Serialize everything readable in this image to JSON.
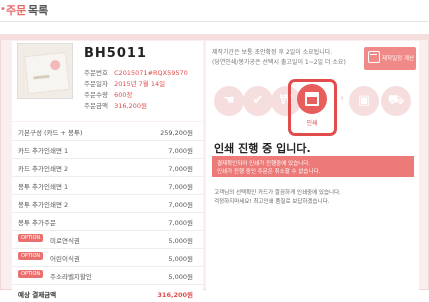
{
  "header": {
    "title_accent": "주문",
    "title_rest": "목록"
  },
  "order": {
    "code": "BH5011",
    "fields": [
      {
        "label": "주문번호",
        "value": "C2015071#RQX59570"
      },
      {
        "label": "주문일자",
        "value": "2015년 7월 14일"
      },
      {
        "label": "주문수량",
        "value": "600장"
      },
      {
        "label": "주문금액",
        "value": "316,200원"
      }
    ]
  },
  "price_rows": [
    {
      "label": "기본구성 (카드 + 봉투)",
      "value": "259,200원"
    },
    {
      "label": "카드 추가인쇄면 1",
      "value": "7,000원"
    },
    {
      "label": "카드 추가인쇄면 2",
      "value": "7,000원"
    },
    {
      "label": "봉투 추가인쇄면 1",
      "value": "7,000원"
    },
    {
      "label": "봉투 추가인쇄면 2",
      "value": "7,000원"
    },
    {
      "label": "봉투 추가주문",
      "value": "7,000원"
    }
  ],
  "option_rows": [
    {
      "badge": "OPTION",
      "label": "미로연식권",
      "value": "5,000원"
    },
    {
      "badge": "OPTION",
      "label": "어린이식권",
      "value": "5,000원"
    },
    {
      "badge": "OPTION",
      "label": "주소라벨지할인",
      "value": "5,000원"
    }
  ],
  "total": {
    "label": "예상 결제금액",
    "value": "316,200원"
  },
  "notice": {
    "line1": "제작기간은 보통 초안확정 후 2일이 소요됩니다.",
    "line2": "(당연인쇄/봉가공은 선택시 출고일이 1~2일 더 소요)"
  },
  "schedule_button": {
    "label": "제작일정 계산"
  },
  "steps": [
    {
      "icon": "hand-icon",
      "glyph": "☚"
    },
    {
      "icon": "check-icon",
      "glyph": "✔"
    },
    {
      "icon": "coin-icon",
      "glyph": "₩"
    },
    {
      "icon": "print-icon",
      "glyph": "",
      "label": "인쇄",
      "active": true
    },
    {
      "icon": "box-icon",
      "glyph": "▣"
    },
    {
      "icon": "truck-icon",
      "glyph": "⛟"
    }
  ],
  "status": {
    "title": "인쇄 진행 중 입니다.",
    "alert_line1": "결제확인되어 인쇄가 진행중에 있습니다.",
    "alert_line2": "인쇄가 진행 중인 주문은 취소할 수 없습니다.",
    "desc_line1": "고객님의 선택확인 카드가 깔끔하게 인쇄중에 있습니다.",
    "desc_line2": "걱정하지마세요! 최고인쇄 품질로 보답하겠습니다."
  },
  "colors": {
    "accent": "#e85e5c",
    "highlight": "#e14d4c",
    "panel_bg": "#fbeeee"
  }
}
